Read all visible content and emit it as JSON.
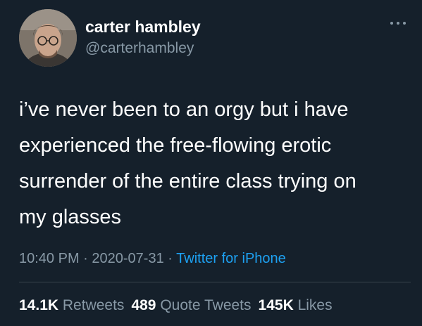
{
  "colors": {
    "background": "#15202b",
    "text_primary": "#ffffff",
    "text_secondary": "#8899a6",
    "link": "#1da1f2",
    "divider": "#38444d"
  },
  "author": {
    "display_name": "carter hambley",
    "handle": "@carterhambley",
    "avatar_icon": "user-avatar-photo",
    "more_icon": "more-horizontal-icon"
  },
  "tweet": {
    "lines": [
      "i’ve never been to an orgy but i have",
      "experienced the free-flowing erotic",
      "surrender of the entire class trying on",
      "my glasses"
    ]
  },
  "meta": {
    "time": "10:40 PM",
    "separator": "·",
    "date": "2020-07-31",
    "source": "Twitter for iPhone"
  },
  "stats": {
    "retweets_count": "14.1K",
    "retweets_label": "Retweets",
    "quotes_count": "489",
    "quotes_label": "Quote Tweets",
    "likes_count": "145K",
    "likes_label": "Likes"
  }
}
